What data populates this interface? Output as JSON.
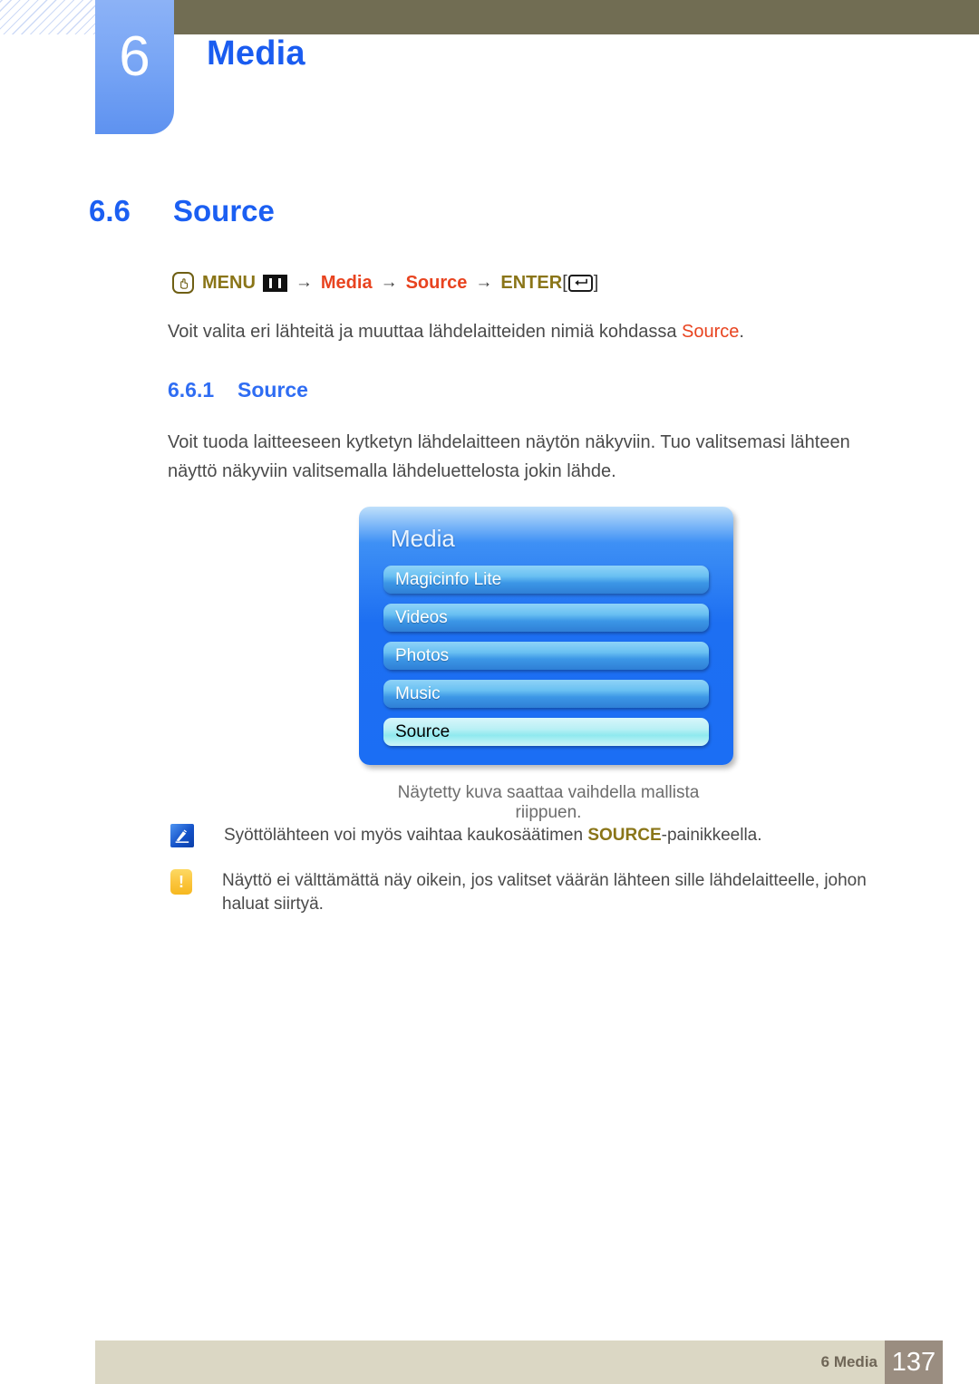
{
  "header": {
    "chapter_number": "6",
    "chapter_title": "Media"
  },
  "section": {
    "number": "6.6",
    "title": "Source"
  },
  "menu_path": {
    "press_icon": "press-button-icon",
    "menu_label": "MENU",
    "menu_icon": "menu-bars-icon",
    "arrow": "→",
    "item_1": "Media",
    "item_2": "Source",
    "enter_label": "ENTER",
    "enter_icon": "enter-key-icon",
    "bracket_open": "[",
    "bracket_close": "]"
  },
  "intro": {
    "text_before": "Voit valita eri lähteitä ja muuttaa lähdelaitteiden nimiä kohdassa ",
    "highlight": "Source",
    "text_after": "."
  },
  "subsection": {
    "number": "6.6.1",
    "title": "Source"
  },
  "description": "Voit tuoda laitteeseen kytketyn lähdelaitteen näytön näkyviin. Tuo valitsemasi lähteen näyttö näkyviin valitsemalla lähdeluettelosta jokin lähde.",
  "osd": {
    "title": "Media",
    "items": [
      {
        "label": "Magicinfo Lite",
        "selected": false
      },
      {
        "label": "Videos",
        "selected": false
      },
      {
        "label": "Photos",
        "selected": false
      },
      {
        "label": "Music",
        "selected": false
      },
      {
        "label": "Source",
        "selected": true
      }
    ]
  },
  "caption": "Näytetty kuva saattaa vaihdella mallista riippuen.",
  "notes": [
    {
      "icon": "note-pen-icon",
      "text_before": "Syöttölähteen voi myös vaihtaa kaukosäätimen ",
      "highlight": "SOURCE",
      "text_after": "-painikkeella."
    },
    {
      "icon": "warning-icon",
      "icon_glyph": "!",
      "text_before": "Näyttö ei välttämättä näy oikein, jos valitset väärän lähteen sille lähdelaitteelle, johon haluat siirtyä.",
      "highlight": "",
      "text_after": ""
    }
  ],
  "footer": {
    "label": "6 Media",
    "page_number": "137"
  },
  "colors": {
    "heading_blue": "#1b5ff2",
    "accent_red": "#e8431f",
    "accent_gold": "#8a7518",
    "topbar_olive": "#716d53",
    "tab_blue": "#79a6f5",
    "footer_band": "#dbd7c4",
    "footer_page_box": "#9a8d80",
    "osd_blue": "#1d6ff2",
    "osd_selected": "#b9f0f5"
  }
}
